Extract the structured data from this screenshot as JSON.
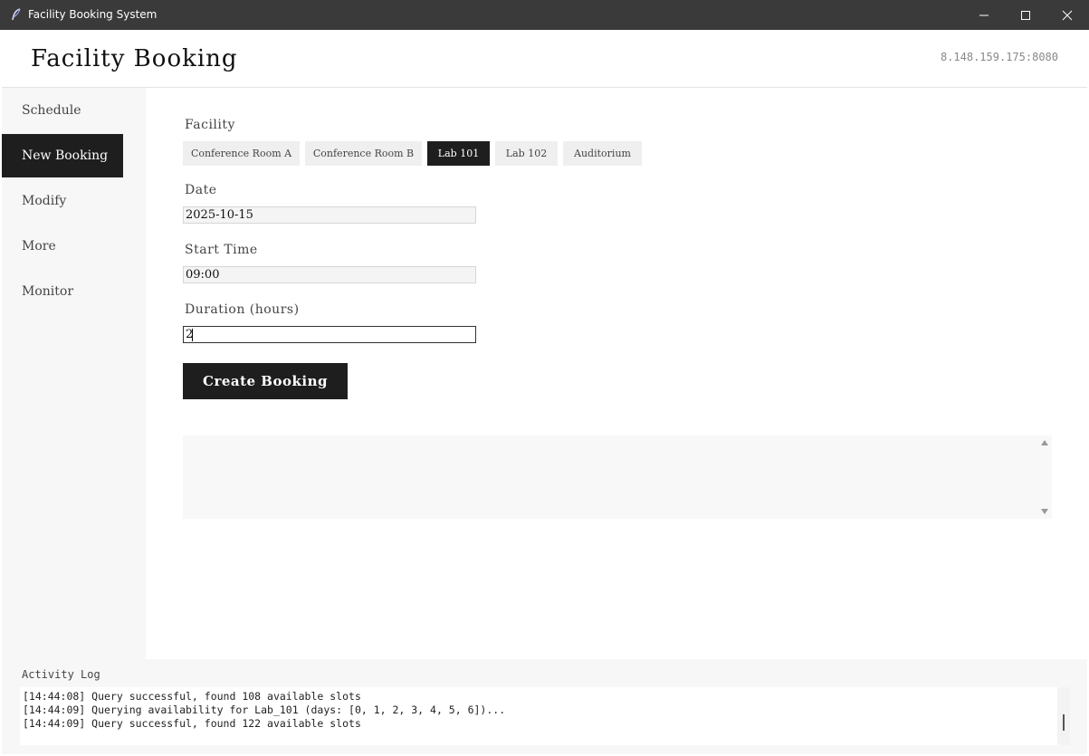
{
  "window": {
    "title": "Facility Booking System",
    "minimize_icon": "minimize-icon",
    "maximize_icon": "maximize-icon",
    "close_icon": "close-icon"
  },
  "header": {
    "title": "Facility Booking",
    "server_address": "8.148.159.175:8080"
  },
  "sidebar": {
    "items": [
      {
        "label": "Schedule",
        "active": false
      },
      {
        "label": "New Booking",
        "active": true
      },
      {
        "label": "Modify",
        "active": false
      },
      {
        "label": "More",
        "active": false
      },
      {
        "label": "Monitor",
        "active": false
      }
    ]
  },
  "form": {
    "facility_label": "Facility",
    "facilities": [
      {
        "label": "Conference Room A",
        "selected": false
      },
      {
        "label": "Conference Room B",
        "selected": false
      },
      {
        "label": "Lab 101",
        "selected": true
      },
      {
        "label": "Lab 102",
        "selected": false
      },
      {
        "label": "Auditorium",
        "selected": false
      }
    ],
    "date_label": "Date",
    "date_value": "2025-10-15",
    "start_label": "Start Time",
    "start_value": "09:00",
    "duration_label": "Duration (hours)",
    "duration_value": "2",
    "submit_label": "Create Booking"
  },
  "result": {
    "text": ""
  },
  "activity_log": {
    "title": "Activity Log",
    "lines": [
      "[14:44:08] Query successful, found 108 available slots",
      "[14:44:09] Querying availability for Lab_101 (days: [0, 1, 2, 3, 4, 5, 6])...",
      "[14:44:09] Query successful, found 122 available slots"
    ]
  },
  "colors": {
    "titlebar": "#3a3a3a",
    "accent_dark": "#1e1e1e",
    "sidebar_bg": "#f7f7f7"
  }
}
